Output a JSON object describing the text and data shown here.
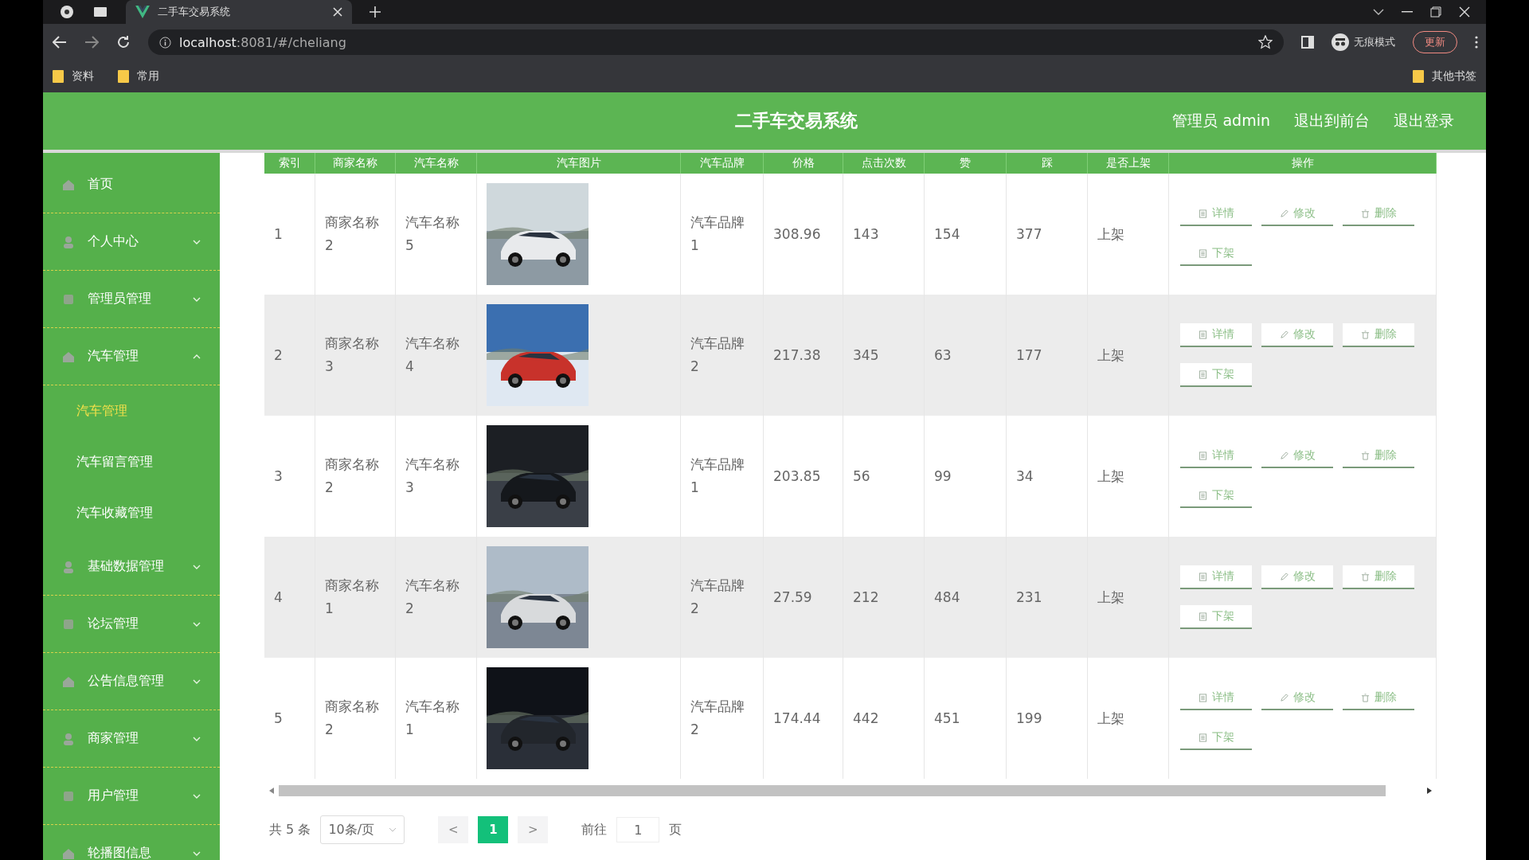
{
  "browser": {
    "tab_title": "二手车交易系统",
    "url_host": "localhost",
    "url_rest": ":8081/#/cheliang",
    "incognito": "无痕模式",
    "update": "更新",
    "bookmarks": [
      "资料",
      "常用"
    ],
    "other_bookmarks": "其他书签"
  },
  "header": {
    "title": "二手车交易系统",
    "user": "管理员 admin",
    "links": [
      "退出到前台",
      "退出登录"
    ]
  },
  "sidebar": {
    "items": [
      {
        "label": "首页",
        "kind": "link"
      },
      {
        "label": "个人中心",
        "kind": "menu",
        "expanded": false
      },
      {
        "label": "管理员管理",
        "kind": "menu",
        "expanded": false
      },
      {
        "label": "汽车管理",
        "kind": "menu",
        "expanded": true,
        "children": [
          {
            "label": "汽车管理",
            "selected": true
          },
          {
            "label": "汽车留言管理",
            "selected": false
          },
          {
            "label": "汽车收藏管理",
            "selected": false
          }
        ]
      },
      {
        "label": "基础数据管理",
        "kind": "menu",
        "expanded": false
      },
      {
        "label": "论坛管理",
        "kind": "menu",
        "expanded": false
      },
      {
        "label": "公告信息管理",
        "kind": "menu",
        "expanded": false
      },
      {
        "label": "商家管理",
        "kind": "menu",
        "expanded": false
      },
      {
        "label": "用户管理",
        "kind": "menu",
        "expanded": false
      },
      {
        "label": "轮播图信息",
        "kind": "menu",
        "expanded": false
      }
    ]
  },
  "table": {
    "columns": [
      "索引",
      "商家名称",
      "汽车名称",
      "汽车图片",
      "汽车品牌",
      "价格",
      "点击次数",
      "赞",
      "踩",
      "是否上架",
      "操作"
    ],
    "rows": [
      {
        "cells": [
          "1",
          "商家名称2",
          "汽车名称5",
          {
            "kind": "picture"
          },
          "汽车品牌1",
          "308.96",
          "143",
          "154",
          "377",
          "上架"
        ],
        "actions": [
          "详情",
          "修改",
          "删除",
          "下架"
        ]
      },
      {
        "cells": [
          "2",
          "商家名称3",
          "汽车名称4",
          {
            "kind": "picture"
          },
          "汽车品牌2",
          "217.38",
          "345",
          "63",
          "177",
          "上架"
        ],
        "actions": [
          "详情",
          "修改",
          "删除",
          "下架"
        ]
      },
      {
        "cells": [
          "3",
          "商家名称2",
          "汽车名称3",
          {
            "kind": "picture"
          },
          "汽车品牌1",
          "203.85",
          "56",
          "99",
          "34",
          "上架"
        ],
        "actions": [
          "详情",
          "修改",
          "删除",
          "下架"
        ]
      },
      {
        "cells": [
          "4",
          "商家名称1",
          "汽车名称2",
          {
            "kind": "picture"
          },
          "汽车品牌2",
          "27.59",
          "212",
          "484",
          "231",
          "上架"
        ],
        "actions": [
          "详情",
          "修改",
          "删除",
          "下架"
        ]
      },
      {
        "cells": [
          "5",
          "商家名称2",
          "汽车名称1",
          {
            "kind": "picture"
          },
          "汽车品牌2",
          "174.44",
          "442",
          "451",
          "199",
          "上架"
        ],
        "actions": [
          "详情",
          "修改",
          "删除",
          "下架"
        ]
      }
    ]
  },
  "pagination": {
    "total": "共 5 条",
    "page_size": "10条/页",
    "prev": "<",
    "pages": [
      {
        "label": "1",
        "selected": true
      }
    ],
    "next": ">",
    "goto": "前往",
    "goto_value": "1",
    "page_unit": "页"
  }
}
